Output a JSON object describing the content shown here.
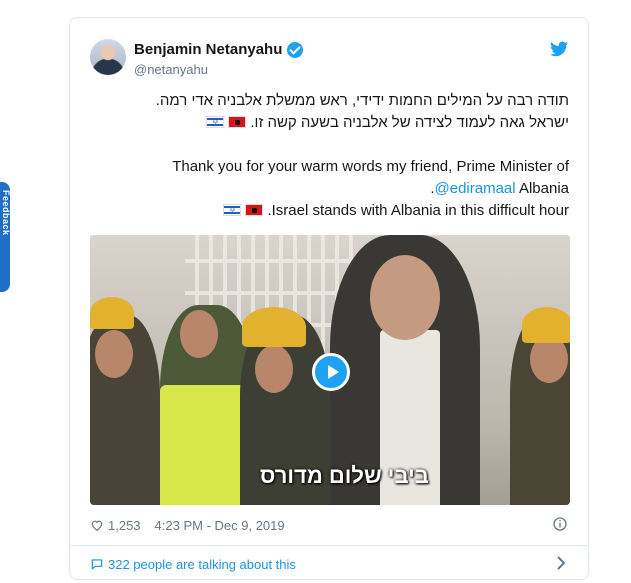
{
  "side_tab": {
    "label": "Feedback"
  },
  "tweet": {
    "author_name": "Benjamin Netanyahu",
    "author_handle": "@netanyahu",
    "text": {
      "hebrew_line_1": "תודה רבה על המילים החמות ידידי, ראש ממשלת אלבניה אדי רמה.",
      "hebrew_line_2": "ישראל גאה לעמוד לצידה של אלבניה בשעה קשה זו.",
      "english_line_1": "Thank you for your warm words my friend, Prime Minister of",
      "english_mention": "@ediramaal",
      "english_line_2_suffix": " Albania",
      "english_line_2_end": ".",
      "english_line_3": ".Israel stands with Albania in this difficult hour"
    },
    "media": {
      "caption": "ביבי שלום מדורס"
    },
    "likes": "1,253",
    "timestamp": "4:23 PM - Dec 9, 2019",
    "talking": "322 people are talking about this"
  },
  "icons": {
    "verified": "verified-badge-icon",
    "twitter": "twitter-bird-icon",
    "heart": "heart-icon",
    "info": "info-icon",
    "comment": "comment-bubble-icon",
    "chevron": "chevron-right-icon"
  },
  "colors": {
    "accent": "#1da1f2",
    "link": "#1b95e0",
    "muted": "#657786",
    "side_tab": "#1f6fc5"
  }
}
